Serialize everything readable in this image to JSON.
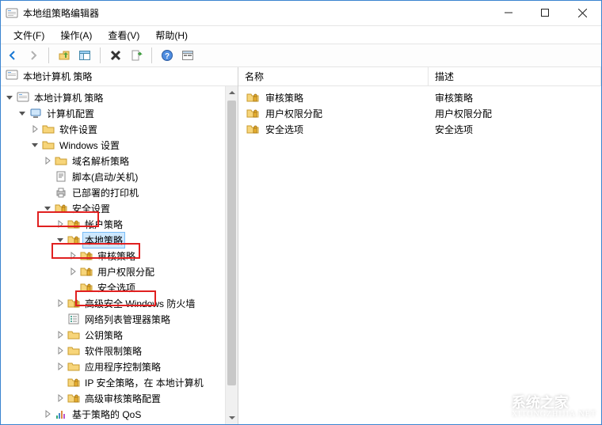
{
  "window": {
    "title": "本地组策略编辑器"
  },
  "menu": {
    "file": "文件(F)",
    "action": "操作(A)",
    "view": "查看(V)",
    "help": "帮助(H)"
  },
  "left": {
    "header": "本地计算机 策略"
  },
  "tree": {
    "root": "本地计算机 策略",
    "compconf": "计算机配置",
    "softset": "软件设置",
    "winset": "Windows 设置",
    "dns": "域名解析策略",
    "scripts": "脚本(启动/关机)",
    "printers": "已部署的打印机",
    "secset": "安全设置",
    "accpol": "帐户策略",
    "localpol": "本地策略",
    "audit": "审核策略",
    "userrights": "用户权限分配",
    "secopt": "安全选项",
    "firewall": "高级安全 Windows 防火墙",
    "netlist": "网络列表管理器策略",
    "pubkey": "公钥策略",
    "softrestrict": "软件限制策略",
    "appcontrol": "应用程序控制策略",
    "ipsec": "IP 安全策略，在 本地计算机",
    "advaudit": "高级审核策略配置",
    "qos": "基于策略的 QoS"
  },
  "columns": {
    "name": "名称",
    "desc": "描述"
  },
  "list": [
    {
      "name": "审核策略",
      "desc": "审核策略"
    },
    {
      "name": "用户权限分配",
      "desc": "用户权限分配"
    },
    {
      "name": "安全选项",
      "desc": "安全选项"
    }
  ],
  "watermark": {
    "brand": "系统之家",
    "sub": "XITONGZHIJIA.NET"
  }
}
